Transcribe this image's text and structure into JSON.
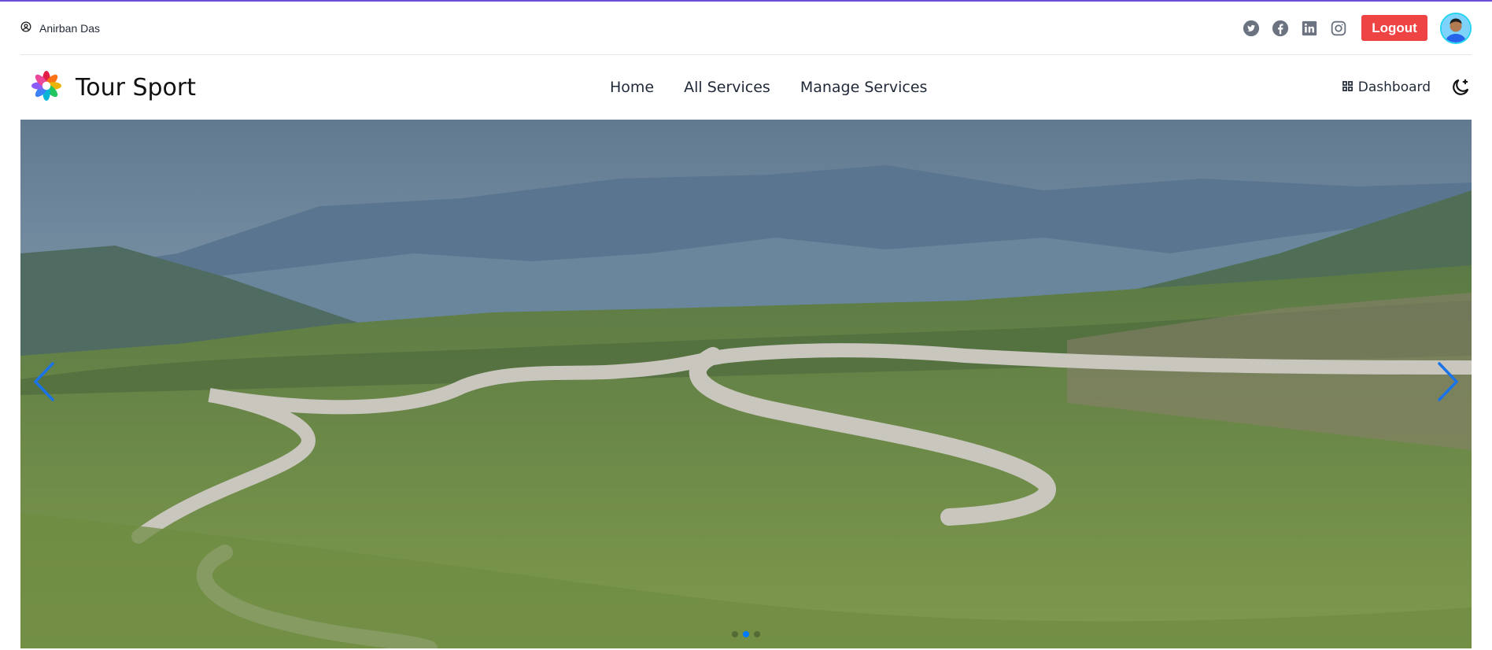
{
  "topbar": {
    "user_name": "Anirban Das",
    "user_icon": "user-circle-icon",
    "social_icons": [
      "twitter-icon",
      "facebook-icon",
      "linkedin-icon",
      "instagram-icon"
    ],
    "logout_label": "Logout"
  },
  "nav": {
    "brand_name": "Tour Sport",
    "links": [
      {
        "label": "Home"
      },
      {
        "label": "All Services"
      },
      {
        "label": "Manage Services"
      }
    ],
    "dashboard_label": "Dashboard",
    "theme_icon": "moon-icon"
  },
  "hero": {
    "slide_count": 3,
    "active_slide": 2,
    "prev_icon": "chevron-left-icon",
    "next_icon": "chevron-right-icon"
  },
  "colors": {
    "accent_line": "#6a4fd6",
    "logout": "#ef4444",
    "carousel_accent": "#007aff"
  }
}
